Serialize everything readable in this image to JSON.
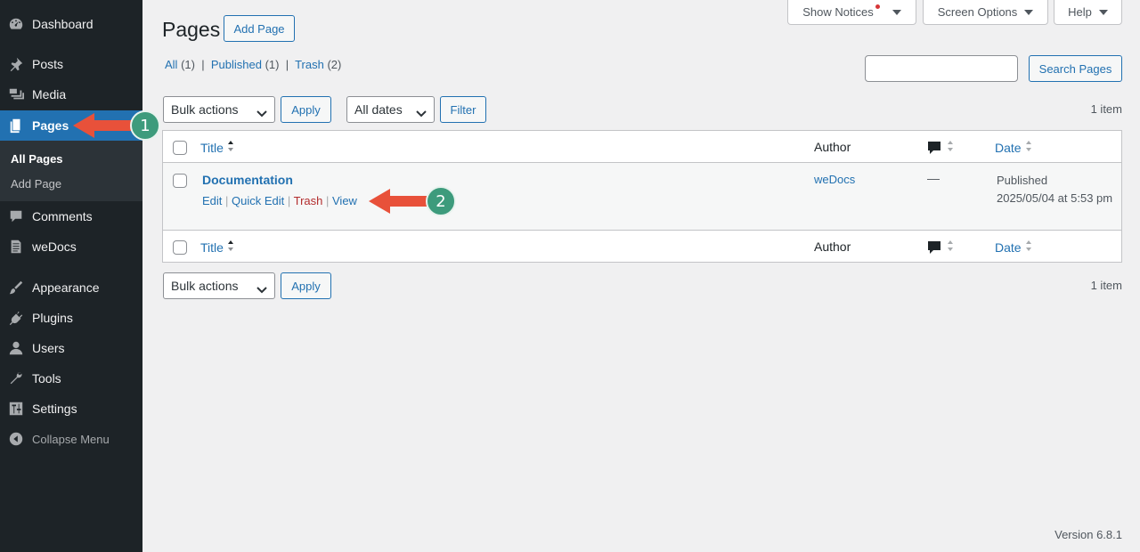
{
  "sidebar": {
    "items": [
      {
        "label": "Dashboard",
        "icon": "dashboard-icon"
      },
      {
        "label": "Posts",
        "icon": "pin-icon"
      },
      {
        "label": "Media",
        "icon": "media-icon"
      },
      {
        "label": "Pages",
        "icon": "page-icon"
      },
      {
        "label": "Comments",
        "icon": "comment-icon"
      },
      {
        "label": "weDocs",
        "icon": "document-icon"
      },
      {
        "label": "Appearance",
        "icon": "brush-icon"
      },
      {
        "label": "Plugins",
        "icon": "plugin-icon"
      },
      {
        "label": "Users",
        "icon": "users-icon"
      },
      {
        "label": "Tools",
        "icon": "wrench-icon"
      },
      {
        "label": "Settings",
        "icon": "settings-icon"
      }
    ],
    "submenu": [
      "All Pages",
      "Add Page"
    ],
    "collapse_label": "Collapse Menu",
    "active_color": "#2271b1"
  },
  "screen_tabs": {
    "notices": "Show Notices",
    "options": "Screen Options",
    "help": "Help"
  },
  "header": {
    "title": "Pages",
    "add_button": "Add Page"
  },
  "views": {
    "all": "All",
    "all_count": "(1)",
    "published": "Published",
    "published_count": "(1)",
    "trash": "Trash",
    "trash_count": "(2)",
    "sep": "|"
  },
  "search": {
    "button": "Search Pages",
    "value": ""
  },
  "tablenav": {
    "bulk_actions": "Bulk actions",
    "apply": "Apply",
    "all_dates": "All dates",
    "filter": "Filter",
    "item_count": "1 item"
  },
  "table": {
    "columns": {
      "title": "Title",
      "author": "Author",
      "date": "Date"
    },
    "rows": [
      {
        "title": "Documentation",
        "actions": {
          "edit": "Edit",
          "quick_edit": "Quick Edit",
          "trash": "Trash",
          "view": "View"
        },
        "author": "weDocs",
        "comments": "—",
        "status": "Published",
        "date": "2025/05/04 at 5:53 pm"
      }
    ]
  },
  "annotations": {
    "badge1": "1",
    "badge2": "2",
    "arrow_color": "#e8513a",
    "badge_color": "#3d9b7c"
  },
  "footer": {
    "version": "Version 6.8.1"
  }
}
